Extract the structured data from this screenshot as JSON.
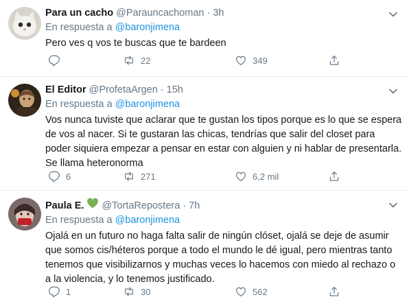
{
  "tweets": [
    {
      "name": "Para un cacho",
      "handle": "@Parauncachoman",
      "dot": "·",
      "time": "3h",
      "reply_prefix": "En respuesta a",
      "reply_to": "@baronjimena",
      "text": "Pero ves q vos te buscas que te bardeen",
      "replies": "",
      "retweets": "22",
      "likes": "349"
    },
    {
      "name": "El Editor",
      "handle": "@ProfetaArgen",
      "dot": "·",
      "time": "15h",
      "reply_prefix": "En respuesta a",
      "reply_to": "@baronjimena",
      "text": "Vos nunca tuviste que aclarar que te gustan los tipos porque es lo que se espera de vos al nacer. Si te gustaran las chicas, tendrías que salir del closet para poder siquiera empezar a pensar en estar con alguien y ni hablar de presentarla.  Se llama heteronorma",
      "replies": "6",
      "retweets": "271",
      "likes": "6,2 mil"
    },
    {
      "name": "Paula E.",
      "handle": "@TortaRepostera",
      "dot": "·",
      "time": "7h",
      "reply_prefix": "En respuesta a",
      "reply_to": "@baronjimena",
      "text": "Ojalá en un futuro no haga falta salir de ningún clóset, ojalá se deje de asumir que somos cis/héteros porque a todo el mundo le dé igual, pero mientras tanto tenemos que visibilizarnos y muchas veces lo hacemos con miedo al rechazo o a la violencia, y lo tenemos justificado.",
      "replies": "1",
      "retweets": "30",
      "likes": "562"
    }
  ],
  "colors": {
    "accent": "#1b95e0",
    "muted": "#657786",
    "text": "#14171a",
    "divider": "#e6ecf0",
    "green_heart": "#77b255"
  },
  "icons": {
    "reply": "reply-icon",
    "retweet": "retweet-icon",
    "like": "like-icon",
    "share": "share-icon",
    "menu": "chevron-down-icon"
  }
}
